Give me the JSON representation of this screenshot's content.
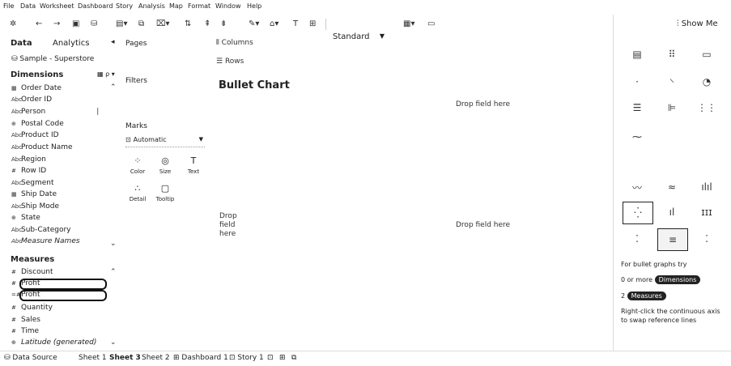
{
  "menu": [
    "File",
    "Data",
    "Worksheet",
    "Dashboard",
    "Story",
    "Analysis",
    "Map",
    "Format",
    "Window",
    "Help"
  ],
  "toolbar": {
    "fit_select": "Standard"
  },
  "data_pane": {
    "tab_data": "Data",
    "tab_analytics": "Analytics",
    "datasource": "Sample - Superstore",
    "dimensions_title": "Dimensions",
    "dimensions": [
      {
        "icon": "calendar",
        "label": "Order Date"
      },
      {
        "icon": "Abc",
        "label": "Order ID"
      },
      {
        "icon": "Abc",
        "label": "Person"
      },
      {
        "icon": "globe",
        "label": "Postal Code"
      },
      {
        "icon": "Abc",
        "label": "Product ID"
      },
      {
        "icon": "Abc",
        "label": "Product Name"
      },
      {
        "icon": "Abc",
        "label": "Region"
      },
      {
        "icon": "#",
        "label": "Row ID"
      },
      {
        "icon": "Abc",
        "label": "Segment"
      },
      {
        "icon": "calendar",
        "label": "Ship Date"
      },
      {
        "icon": "Abc",
        "label": "Ship Mode"
      },
      {
        "icon": "globe",
        "label": "State"
      },
      {
        "icon": "Abc",
        "label": "Sub-Category"
      },
      {
        "icon": "Abc",
        "label": "Measure Names"
      }
    ],
    "measures_title": "Measures",
    "measures": [
      {
        "icon": "#",
        "label": "Discount"
      },
      {
        "icon": "#",
        "label": "Profit"
      },
      {
        "icon": "=#",
        "label": "Profit"
      },
      {
        "icon": "#",
        "label": "Quantity"
      },
      {
        "icon": "#",
        "label": "Sales"
      },
      {
        "icon": "#",
        "label": "Time"
      },
      {
        "icon": "globe",
        "label": "Latitude (generated)"
      }
    ]
  },
  "cards": {
    "pages": "Pages",
    "filters": "Filters",
    "marks": "Marks",
    "marks_type": "Automatic",
    "marks_buttons": [
      "Color",
      "Size",
      "Text",
      "Detail",
      "Tooltip"
    ]
  },
  "shelves": {
    "columns": "Columns",
    "rows": "Rows"
  },
  "view": {
    "title": "Bullet Chart",
    "drop_top": "Drop field here",
    "drop_left_lines": [
      "Drop",
      "field",
      "here"
    ],
    "drop_center": "Drop field here"
  },
  "showme": {
    "title": "Show Me",
    "hint_title": "For bullet graphs try",
    "dim_prefix": "0 or more",
    "dim_pill": "Dimensions",
    "meas_prefix": "2",
    "meas_pill": "Measures",
    "note": "Right-click the continuous axis to swap reference lines"
  },
  "tabs": {
    "datasource": "Data Source",
    "sheets": [
      "Sheet 1",
      "Sheet 3",
      "Sheet 2",
      "Dashboard 1",
      "Story 1"
    ],
    "active_sheet": "Sheet 3"
  }
}
